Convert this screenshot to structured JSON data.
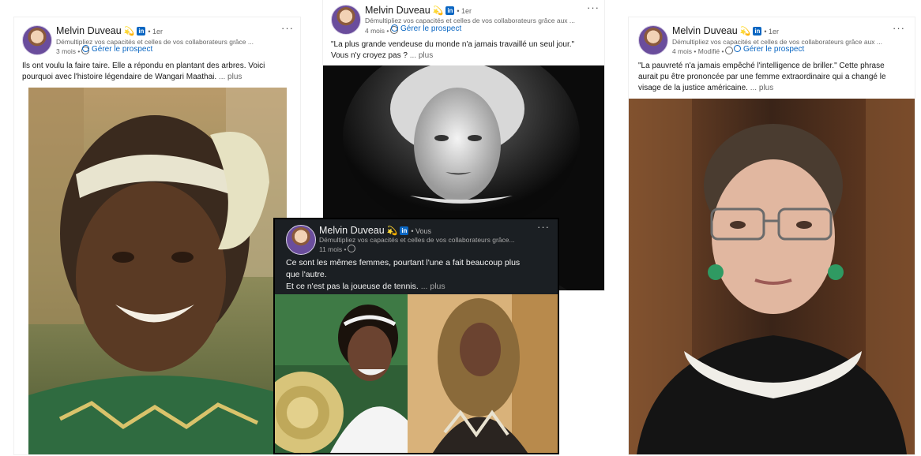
{
  "posts": [
    {
      "author": "Melvin Duveau",
      "emoji": "💫",
      "linkedin_badge": "in",
      "degree": "• 1er",
      "headline": "Démultipliez vos capacités et celles de vos collaborateurs grâce ...",
      "meta": "3 mois •",
      "manage": "Gérer le prospect",
      "menu": "···",
      "text": "Ils ont voulu la faire taire. Elle a répondu en plantant des arbres. Voici pourquoi avec l'histoire légendaire de Wangari Maathai.",
      "more": "... plus"
    },
    {
      "author": "Melvin Duveau",
      "emoji": "💫",
      "linkedin_badge": "in",
      "degree": "• 1er",
      "headline": "Démultipliez vos capacités et celles de vos collaborateurs grâce aux ...",
      "meta": "4 mois •",
      "manage": "Gérer le prospect",
      "menu": "···",
      "text_line1": "\"La plus grande vendeuse du monde n'a jamais travaillé un seul jour.\"",
      "text_line2": "Vous n'y croyez pas ?",
      "more": "... plus"
    },
    {
      "author": "Melvin Duveau",
      "emoji": "💫",
      "linkedin_badge": "in",
      "degree": "• 1er",
      "headline": "Démultipliez vos capacités et celles de vos collaborateurs grâce aux ...",
      "meta": "4 mois • Modifié •",
      "manage": "Gérer le prospect",
      "menu": "···",
      "text": "\"La pauvreté n'a jamais empêché l'intelligence de briller.\" Cette phrase aurait pu être prononcée par une femme extraordinaire qui a changé le visage de la justice américaine.",
      "more": "... plus"
    },
    {
      "author": "Melvin Duveau",
      "emoji": "💫",
      "linkedin_badge": "in",
      "degree": "• Vous",
      "headline": "Démultipliez vos capacités et celles de vos collaborateurs grâce...",
      "meta": "11 mois •",
      "menu": "···",
      "text_line1": "Ce sont les mêmes femmes, pourtant l'une a fait beaucoup plus que l'autre.",
      "text_line2": "Et ce n'est pas la joueuse de tennis.",
      "more": "... plus"
    }
  ]
}
